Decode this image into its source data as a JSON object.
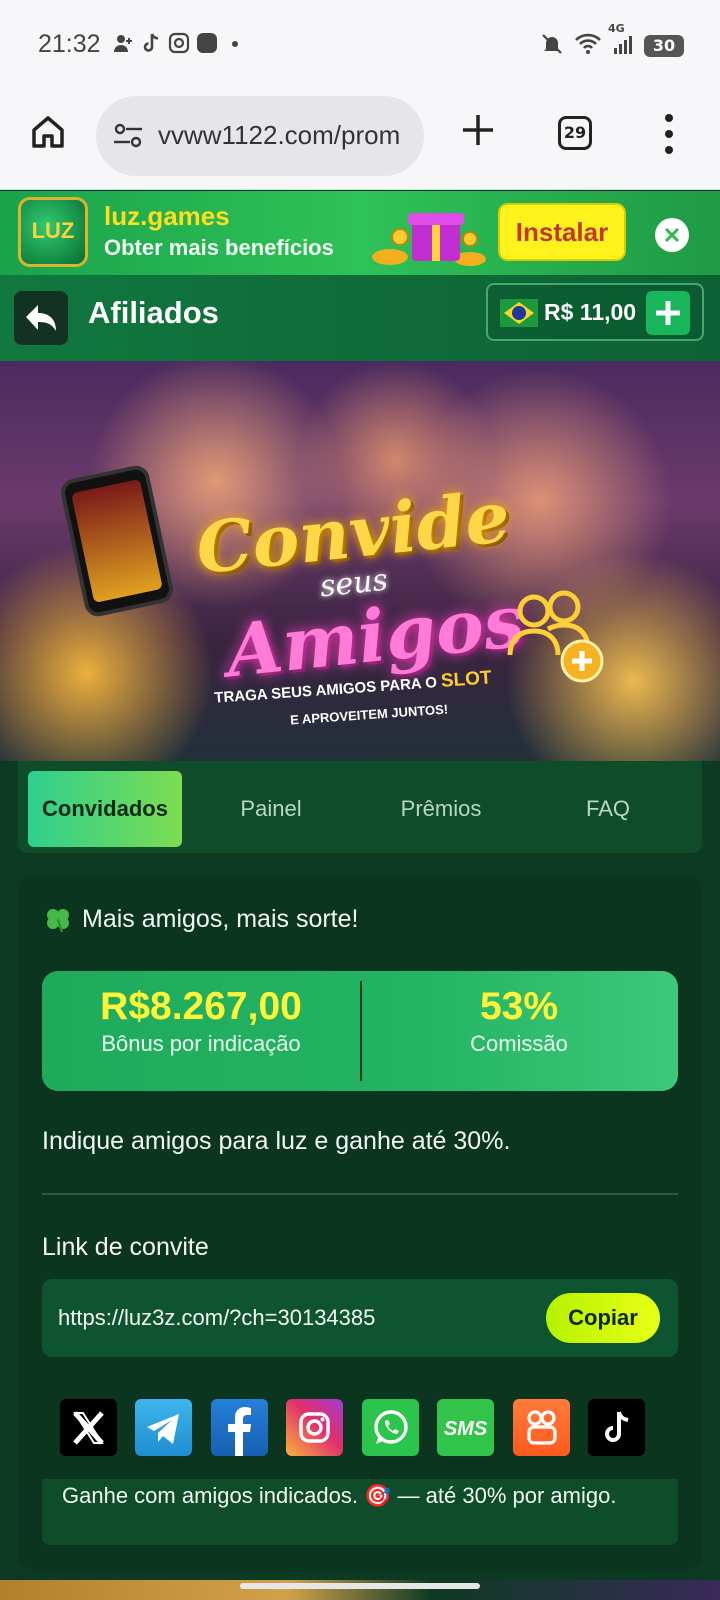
{
  "status_bar": {
    "time": "21:32",
    "network": "4G",
    "battery": "30"
  },
  "browser": {
    "url": "vvww1122.com/prom",
    "tab_count": "29"
  },
  "install_banner": {
    "app_name": "luz.games",
    "subtitle": "Obter mais benefícios",
    "install_label": "Instalar",
    "logo_text": "LUZ"
  },
  "header": {
    "title": "Afiliados",
    "balance": "R$ 11,00"
  },
  "hero": {
    "title_line1": "Convide",
    "title_line2": "seus",
    "title_line3": "Amigos",
    "subtitle_prefix": "TRAGA SEUS AMIGOS PARA O",
    "subtitle_highlight": "SLOT",
    "subtitle_line2": "E APROVEITEM JUNTOS!"
  },
  "tabs": [
    {
      "label": "Convidados",
      "active": true
    },
    {
      "label": "Painel",
      "active": false
    },
    {
      "label": "Prêmios",
      "active": false
    },
    {
      "label": "FAQ",
      "active": false
    }
  ],
  "card": {
    "tagline": "Mais amigos, mais sorte!",
    "bonus_value": "R$8.267,00",
    "bonus_label": "Bônus por indicação",
    "commission_value": "53%",
    "commission_label": "Comissão",
    "refer_text": "Indique amigos para luz e ganhe até 30%.",
    "link_label": "Link de convite",
    "invite_url": "https://luz3z.com/?ch=30134385",
    "copy_label": "Copiar",
    "footnote": "Ganhe com amigos indicados. 🎯 — até 30% por amigo."
  },
  "share_buttons": [
    {
      "name": "x",
      "label": "X",
      "color": "#000000"
    },
    {
      "name": "telegram",
      "label": "",
      "color": "#2aa3e0"
    },
    {
      "name": "facebook",
      "label": "f",
      "color": "#1a73c9"
    },
    {
      "name": "instagram",
      "label": "",
      "color": "#e1306c"
    },
    {
      "name": "whatsapp",
      "label": "",
      "color": "#2bc44c"
    },
    {
      "name": "sms",
      "label": "SMS",
      "color": "#32c44a"
    },
    {
      "name": "kwai",
      "label": "",
      "color": "#ff6a2c"
    },
    {
      "name": "tiktok",
      "label": "",
      "color": "#000000"
    }
  ],
  "colors": {
    "page_bg": "#0d3a22",
    "accent_yellow": "#fff43a",
    "accent_green": "#1faa5c"
  }
}
